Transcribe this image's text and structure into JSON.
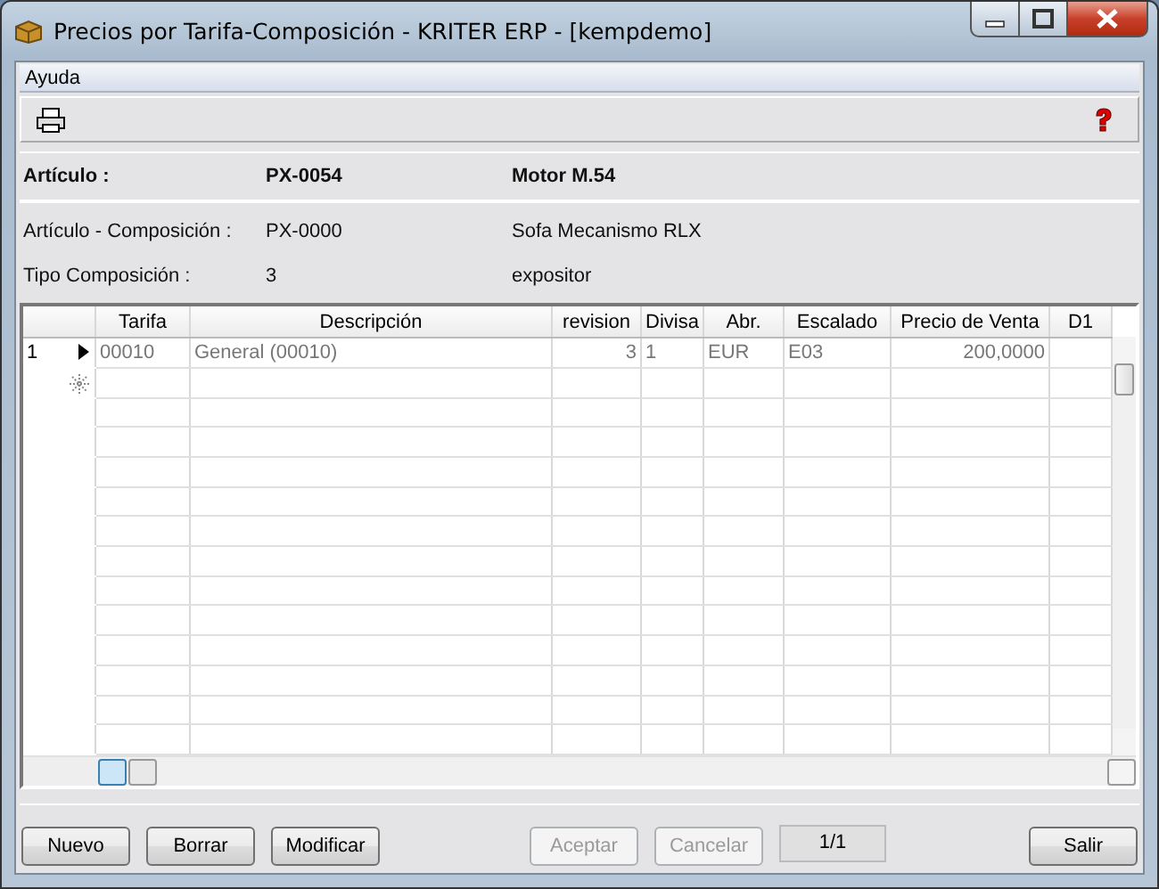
{
  "window": {
    "title": "Precios por Tarifa-Composición - KRITER ERP - [kempdemo]"
  },
  "menu": [
    {
      "label": "Ayuda"
    }
  ],
  "header": [
    {
      "label": "Artículo :",
      "code": "PX-0054",
      "name": "Motor M.54",
      "kind": "main"
    },
    {
      "label": "Artículo - Composición :",
      "code": "PX-0000",
      "name": "Sofa Mecanismo RLX",
      "kind": "detail"
    },
    {
      "label": "Tipo Composición :",
      "code": "3",
      "name": "expositor",
      "kind": "detail"
    }
  ],
  "table": {
    "columns": [
      {
        "label": "Tarifa"
      },
      {
        "label": "Descripción"
      },
      {
        "label": "revision"
      },
      {
        "label": "Divisa"
      },
      {
        "label": "Abr."
      },
      {
        "label": "Escalado"
      },
      {
        "label": "Precio de Venta"
      },
      {
        "label": "D1"
      }
    ],
    "rows": [
      {
        "number": "1",
        "current": true,
        "cells": [
          "00010",
          "General (00010)",
          "3",
          "1",
          "EUR",
          "E03",
          "200,0000",
          ""
        ]
      }
    ]
  },
  "buttons": [
    {
      "label": "Nuevo",
      "disabled": false,
      "kind": "left"
    },
    {
      "label": "Borrar",
      "disabled": false,
      "kind": "left"
    },
    {
      "label": "Modificar",
      "disabled": false,
      "kind": "left"
    },
    {
      "label": "Aceptar",
      "disabled": true,
      "kind": "middle"
    },
    {
      "label": "Cancelar",
      "disabled": true,
      "kind": "middle"
    },
    {
      "label": "Salir",
      "disabled": false,
      "kind": "right"
    }
  ],
  "record_counter": "1/1"
}
